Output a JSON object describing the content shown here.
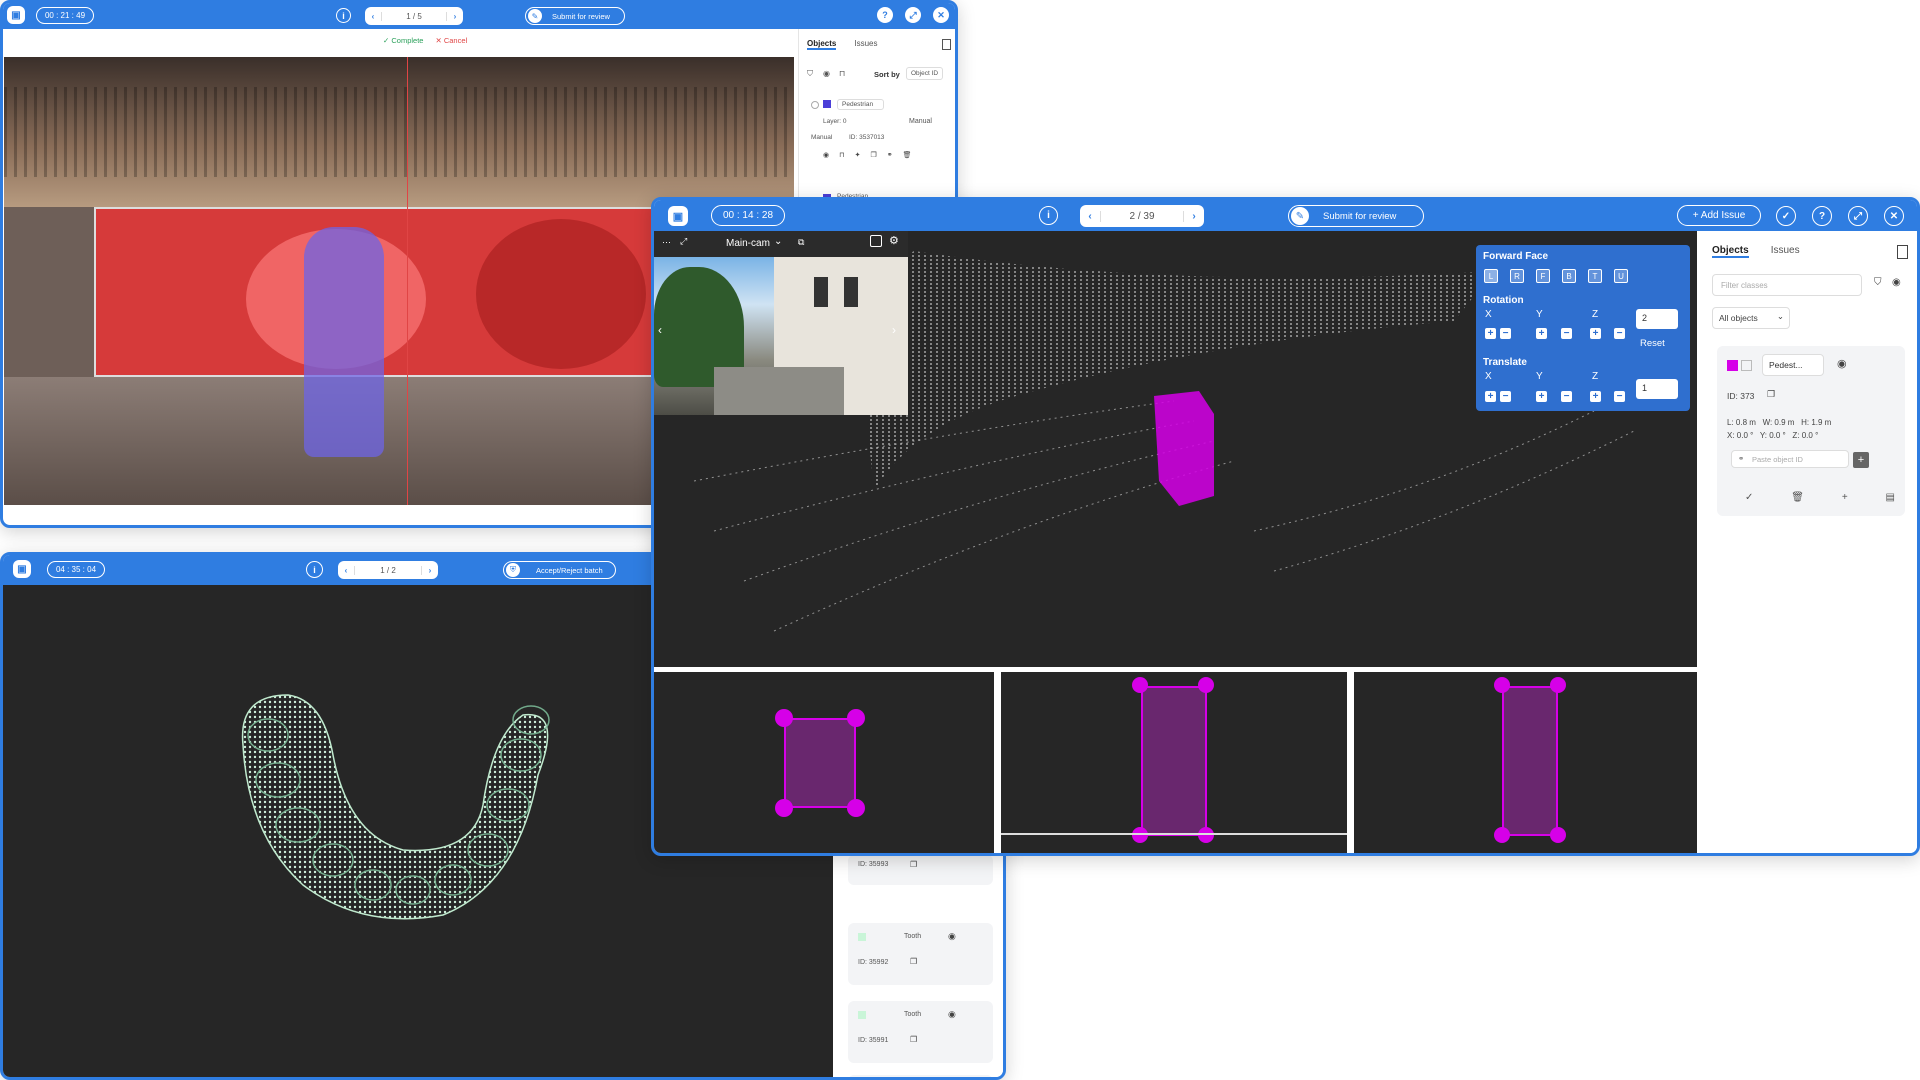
{
  "colors": {
    "accent": "#2f7de1",
    "magenta": "#d600e8",
    "dark_canvas": "#262626",
    "tooth": "#c9f5d8"
  },
  "win_image": {
    "timer": "00 : 21 : 49",
    "info_icon": "info-icon",
    "pager": "1 / 5",
    "submit_label": "Submit for review",
    "complete_label": "✓ Complete",
    "cancel_label": "✕ Cancel",
    "tabs": [
      "Objects",
      "Issues"
    ],
    "sort_by_label": "Sort by",
    "sort_by_value": "Object ID",
    "object": {
      "class": "Pedestrian",
      "layer": "Layer: 0",
      "mode": "Manual",
      "source": "Manual",
      "id": "ID: 3537013"
    },
    "next_object_class": "Pedestrian"
  },
  "win_teeth": {
    "timer": "04 : 35 : 04",
    "pager": "1 / 2",
    "action_label": "Accept/Reject batch",
    "items": [
      {
        "id": "ID: 35993"
      },
      {
        "class": "Tooth",
        "id": "ID: 35992"
      },
      {
        "class": "Tooth",
        "id": "ID: 35991"
      },
      {
        "class": "Tooth"
      }
    ]
  },
  "win_lidar": {
    "timer": "00 : 14 : 28",
    "pager": "2 / 39",
    "submit_label": "Submit for review",
    "add_issue_label": "+ Add Issue",
    "camera_label": "Main-cam",
    "forward_face": {
      "title": "Forward Face",
      "faces": [
        "L",
        "R",
        "F",
        "B",
        "T",
        "U"
      ],
      "rotation_label": "Rotation",
      "rotation_value": "2",
      "reset_label": "Reset",
      "translate_label": "Translate",
      "translate_value": "1",
      "axes": [
        "X",
        "Y",
        "Z"
      ]
    },
    "tabs": [
      "Objects",
      "Issues"
    ],
    "filter_placeholder": "Filter classes",
    "all_objects": "All objects",
    "object": {
      "class": "Pedest...",
      "id": "ID: 373",
      "dims": "L: 0.8 m   W: 0.9 m   H: 1.9 m",
      "rot": "X: 0.0 °   Y: 0.0 °   Z: 0.0 °",
      "paste_placeholder": "Paste object ID"
    }
  }
}
